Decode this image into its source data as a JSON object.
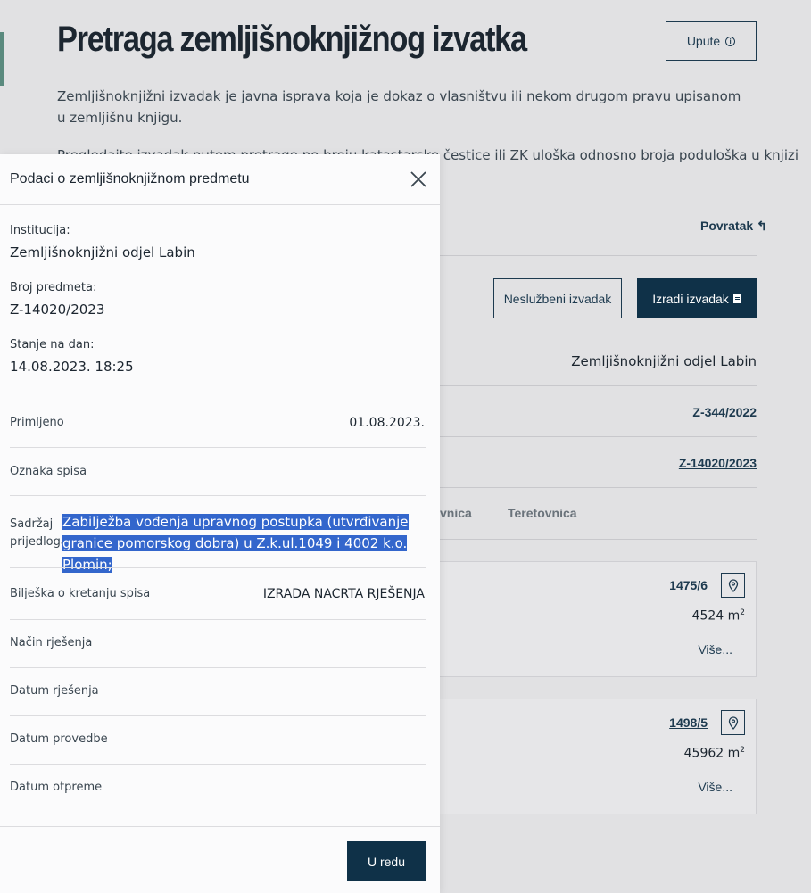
{
  "page": {
    "title": "Pretraga zemljišnoknjižnog izvatka",
    "help_button": "Upute",
    "intro_text": "Zemljišnoknjižni izvadak je javna isprava koja je dokaz o vlasništvu ili nekom drugom pravu upisanom u zemljišnu knjigu.",
    "intro_text_2": "Pregledajte izvadak putem pretrage po broju katastarske čestice ili ZK uloška odnosno broja poduloška u knjizi",
    "back_link": "Povratak ↰",
    "unofficial_button": "Neslužbeni izvadak",
    "create_button": "Izradi izvadak",
    "department": "Zemljišnoknjižni odjel Labin",
    "link_1": "Z-344/2022",
    "link_2": "Z-14020/2023",
    "tabs": [
      "vnica",
      "Teretovnica"
    ],
    "parcels": [
      {
        "number": "1475/6",
        "area": "4524 m",
        "area_unit_exp": "2",
        "more": "Više..."
      },
      {
        "number": "1498/5",
        "area": "45962 m",
        "area_unit_exp": "2",
        "more": "Više..."
      }
    ]
  },
  "modal": {
    "title": "Podaci o zemljišnoknjižnom predmetu",
    "institution_label": "Institucija:",
    "institution_value": "Zemljišnoknjižni odjel Labin",
    "case_number_label": "Broj predmeta:",
    "case_number_value": "Z-14020/2023",
    "state_label": "Stanje na dan:",
    "state_value": "14.08.2023. 18:25",
    "rows": {
      "received_label": "Primljeno",
      "received_value": "01.08.2023.",
      "file_mark_label": "Oznaka spisa",
      "proposal_label": "Sadržaj prijedloga",
      "proposal_value": "Zabilježba vođenja upravnog postupka (utvrđivanje granice pomorskog dobra) u Z.k.ul.1049 i 4002 k.o. Plomin;",
      "note_label": "Bilješka o kretanju spisa",
      "note_value": "IZRADA NACRTA RJEŠENJA",
      "resolution_method_label": "Način rješenja",
      "resolution_date_label": "Datum rješenja",
      "execution_date_label": "Datum provedbe",
      "dispatch_date_label": "Datum otpreme"
    },
    "ok_button": "U redu"
  }
}
